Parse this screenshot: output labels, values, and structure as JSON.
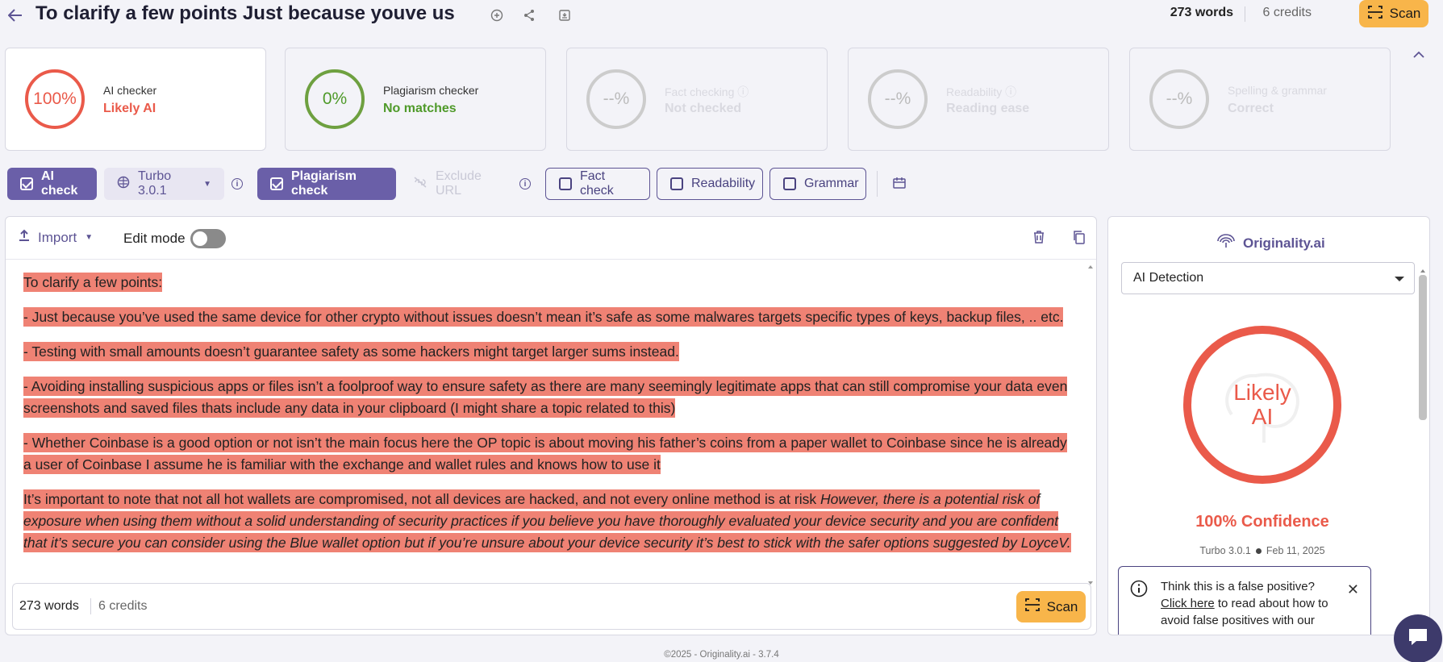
{
  "header": {
    "title": "To clarify a few points Just because youve us",
    "words": "273 words",
    "credits": "6 credits",
    "scan_label": "Scan"
  },
  "cards": [
    {
      "value": "100%",
      "label": "AI checker",
      "status": "Likely AI",
      "ring_color": "#ea5a4a",
      "status_color": "#ea5a4a",
      "active": true
    },
    {
      "value": "0%",
      "label": "Plagiarism checker",
      "status": "No matches",
      "ring_color": "#6ea040",
      "status_color": "#4f9a2a",
      "active": false
    },
    {
      "value": "--%",
      "label": "Fact checking",
      "status": "Not checked",
      "active": false,
      "disabled": true
    },
    {
      "value": "--%",
      "label": "Readability",
      "status": "Reading ease",
      "active": false,
      "disabled": true
    },
    {
      "value": "--%",
      "label": "Spelling & grammar",
      "status": "Correct",
      "active": false,
      "disabled": true
    }
  ],
  "toolbar": {
    "ai_check": "AI check",
    "model": "Turbo 3.0.1",
    "plagiarism_check": "Plagiarism check",
    "exclude_url": "Exclude URL",
    "fact_check": "Fact check",
    "readability": "Readability",
    "grammar": "Grammar"
  },
  "editor": {
    "import_label": "Import",
    "edit_mode_label": "Edit mode",
    "edit_mode_on": false,
    "paragraphs": [
      "To clarify a few points:",
      "- Just because you’ve used the same device for other crypto without issues doesn’t mean it’s safe as some malwares targets specific types of keys, backup files, .. etc.",
      "- Testing with small amounts doesn’t guarantee safety as some hackers might target larger sums instead.",
      "- Avoiding installing suspicious apps or files isn’t a foolproof way to ensure safety as there are many seemingly legitimate apps that can still compromise your data even screenshots and saved files thats include any data in your clipboard (I might share a topic related to this)",
      "- Whether Coinbase is a good option or not isn’t the main focus here the OP topic is about moving his father’s coins from a paper wallet to Coinbase since he is already a user of Coinbase I assume he is familiar with the exchange and wallet rules and knows how to use it"
    ],
    "last_paragraph_plain": "It’s important to note that not all hot wallets are compromised, not all devices are hacked, and not every online method is at risk ",
    "last_paragraph_italic": "However, there is a potential risk of exposure when using them without a solid understanding of security practices if you believe you have thoroughly evaluated your device security and you are confident that it’s secure you can consider using the Blue wallet option but if you’re unsure about your device security it’s best to stick with the safer options suggested by LoyceV.",
    "highlight_color": "#ef8274",
    "footer_words": "273 words",
    "footer_credits": "6 credits",
    "scan_label": "Scan"
  },
  "panel": {
    "brand": "Originality.ai",
    "dropdown_value": "AI Detection",
    "ring_label_line1": "Likely",
    "ring_label_line2": "AI",
    "confidence": "100% Confidence",
    "model": "Turbo 3.0.1",
    "date": "Feb 11, 2025",
    "fp_title": "Think this is a false positive?",
    "fp_link": "Click here",
    "fp_rest": " to read about how to avoid false positives with our"
  },
  "footer": "©2025 - Originality.ai - 3.7.4",
  "colors": {
    "accent": "#6a5fa8",
    "scan": "#f8b54a",
    "ai": "#ea5a4a"
  }
}
